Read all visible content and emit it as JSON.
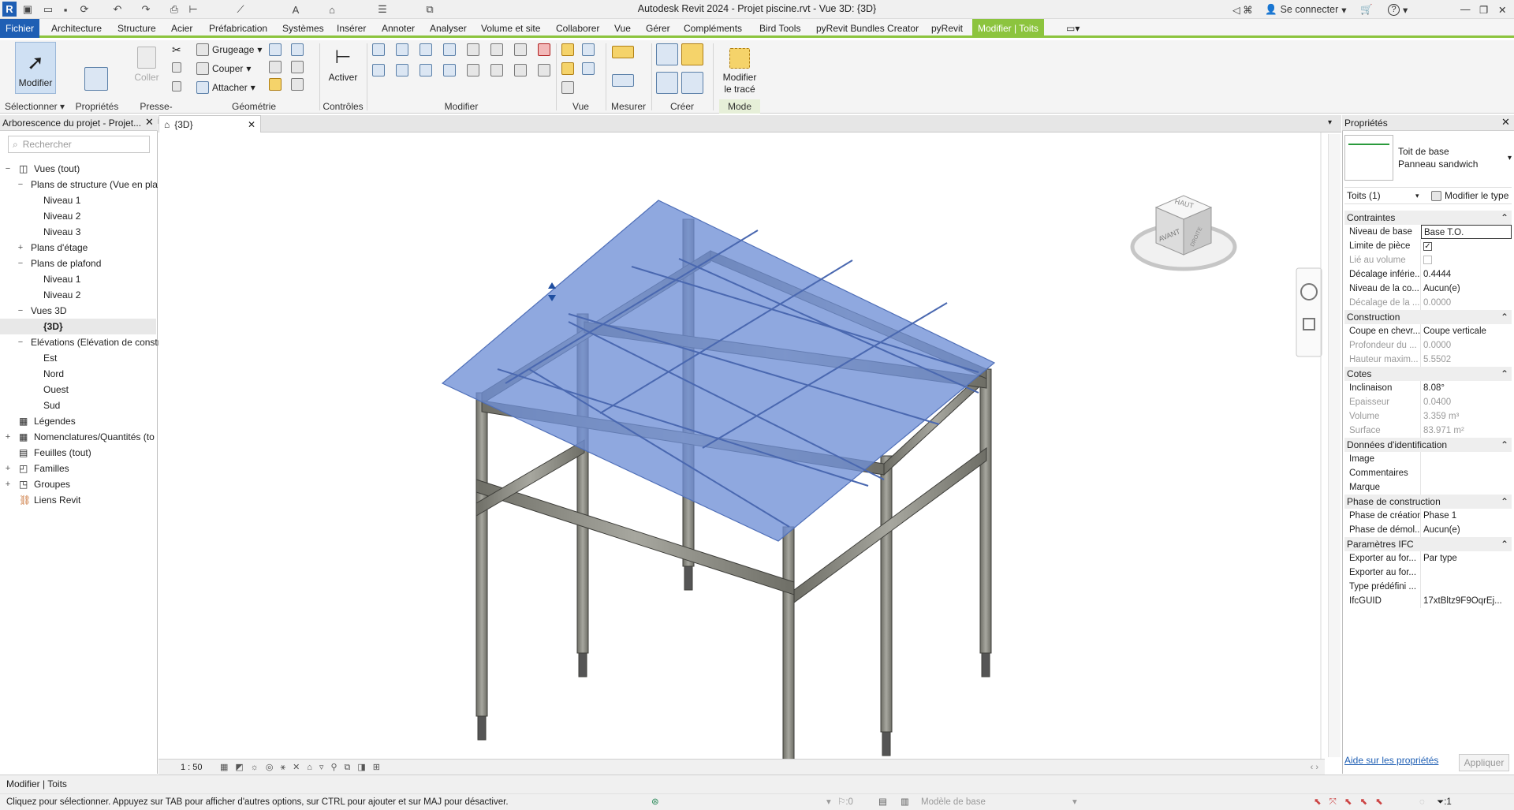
{
  "titlebar": {
    "title": "Autodesk Revit 2024 - Projet piscine.rvt - Vue 3D: {3D}",
    "sign_in": "Se connecter",
    "help": "?"
  },
  "menu": {
    "tabs": [
      "Fichier",
      "Architecture",
      "Structure",
      "Acier",
      "Préfabrication",
      "Systèmes",
      "Insérer",
      "Annoter",
      "Analyser",
      "Volume et site",
      "Collaborer",
      "Vue",
      "Gérer",
      "Compléments",
      "Bird Tools",
      "pyRevit Bundles Creator",
      "pyRevit",
      "Modifier | Toits"
    ]
  },
  "ribbon": {
    "modifier": "Modifier",
    "proprietes": "Propriétés",
    "coller": "Coller",
    "grugeage": "Grugeage",
    "couper": "Couper",
    "attacher": "Attacher",
    "activer": "Activer",
    "modifier_trace_1": "Modifier",
    "modifier_trace_2": "le tracé",
    "panels": {
      "selectionner": "Sélectionner",
      "proprietes": "Propriétés",
      "presse_papiers": "Presse-papiers",
      "geometrie": "Géométrie",
      "controles": "Contrôles",
      "modifier": "Modifier",
      "vue": "Vue",
      "mesurer": "Mesurer",
      "creer": "Créer",
      "mode": "Mode"
    }
  },
  "project_browser": {
    "header": "Arborescence du projet - Projet...",
    "search_placeholder": "Rechercher",
    "items": [
      "Vues (tout)",
      "Plans de structure (Vue en pla",
      "Niveau 1",
      "Niveau 2",
      "Niveau 3",
      "Plans d'étage",
      "Plans de plafond",
      "Niveau 1",
      "Niveau 2",
      "Vues 3D",
      "{3D}",
      "Elévations (Elévation de constr",
      "Est",
      "Nord",
      "Ouest",
      "Sud",
      "Légendes",
      "Nomenclatures/Quantités (to",
      "Feuilles (tout)",
      "Familles",
      "Groupes",
      "Liens Revit"
    ]
  },
  "view": {
    "tab": "{3D}",
    "scale": "1 : 50",
    "cube_top": "HAUT",
    "cube_front": "AVANT",
    "cube_right": "DROITE"
  },
  "properties": {
    "header": "Propriétés",
    "type_line1": "Toit de base",
    "type_line2": "Panneau sandwich",
    "selector": "Toits (1)",
    "edit_type": "Modifier le type",
    "sections": {
      "contraintes": "Contraintes",
      "construction": "Construction",
      "cotes": "Cotes",
      "donnees": "Données d'identification",
      "phase": "Phase de construction",
      "ifc": "Paramètres IFC"
    },
    "rows": {
      "niveau_base": [
        "Niveau de base",
        "Base T.O."
      ],
      "limite": [
        "Limite de pièce",
        ""
      ],
      "lie_volume": [
        "Lié au volume",
        ""
      ],
      "decalage_inf": [
        "Décalage inférie...",
        "0.4444"
      ],
      "niveau_coupe": [
        "Niveau de la co...",
        "Aucun(e)"
      ],
      "decalage_la": [
        "Décalage de la ...",
        "0.0000"
      ],
      "coupe_chevron": [
        "Coupe en chevr...",
        "Coupe verticale"
      ],
      "profondeur": [
        "Profondeur du ...",
        "0.0000"
      ],
      "hauteur_max": [
        "Hauteur maxim...",
        "5.5502"
      ],
      "inclinaison": [
        "Inclinaison",
        "8.08°"
      ],
      "epaisseur": [
        "Epaisseur",
        "0.0400"
      ],
      "volume": [
        "Volume",
        "3.359 m³"
      ],
      "surface": [
        "Surface",
        "83.971 m²"
      ],
      "image": [
        "Image",
        ""
      ],
      "commentaires": [
        "Commentaires",
        ""
      ],
      "marque": [
        "Marque",
        ""
      ],
      "phase_creation": [
        "Phase de création",
        "Phase 1"
      ],
      "phase_demol": [
        "Phase de démol...",
        "Aucun(e)"
      ],
      "exporter1": [
        "Exporter au for...",
        "Par type"
      ],
      "exporter2": [
        "Exporter au for...",
        ""
      ],
      "type_predef": [
        "Type prédéfini ...",
        ""
      ],
      "ifcguid": [
        "IfcGUID",
        "17xtBltz9F9OqrEj..."
      ]
    },
    "help_link": "Aide sur les propriétés",
    "apply": "Appliquer"
  },
  "status": {
    "mode": "Modifier | Toits",
    "hint": "Cliquez pour sélectionner. Appuyez sur TAB pour afficher d'autres options, sur CTRL pour ajouter et sur MAJ pour désactiver.",
    "zero": ":0",
    "model": "Modèle de base",
    "filter": ":1"
  },
  "colors": {
    "accent_green": "#8cc43e",
    "file_blue": "#1f5fb4",
    "roof": "#6f8fd6",
    "steel": "#8a8a82"
  }
}
